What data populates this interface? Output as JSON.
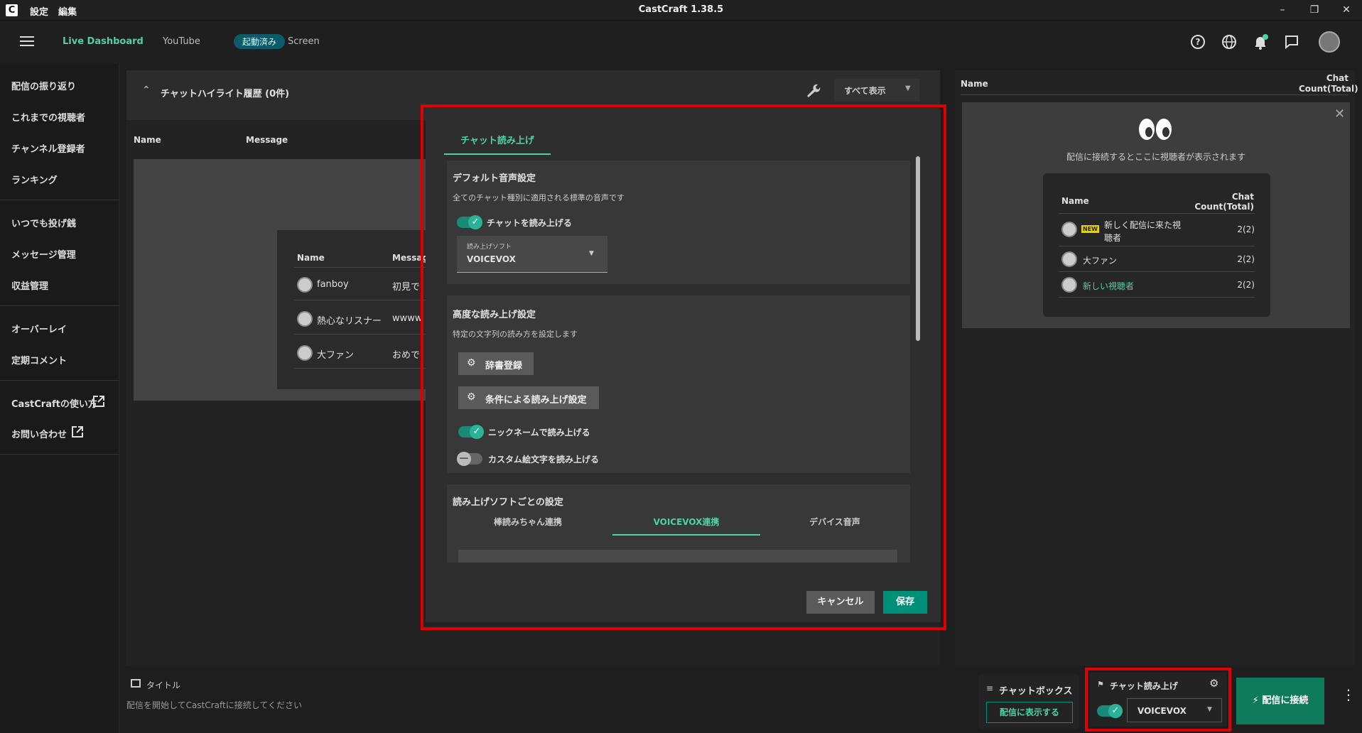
{
  "app": {
    "title": "CastCraft 1.38.5",
    "menu": [
      "設定",
      "編集"
    ],
    "logo": "C",
    "window_controls": [
      "–",
      "❐",
      "✕"
    ]
  },
  "nav": {
    "tabs": [
      "Live Dashboard",
      "YouTube"
    ],
    "status_pill": "起動済み",
    "screen_tab": "Screen",
    "icons": [
      "help-icon",
      "globe-icon",
      "bell-icon",
      "chat-icon",
      "avatar"
    ]
  },
  "sidebar": {
    "items": [
      "配信の振り返り",
      "これまでの視聴者",
      "チャンネル登録者",
      "ランキング",
      "いつでも投げ銭",
      "メッセージ管理",
      "収益管理",
      "オーバーレイ",
      "定期コメント",
      "CastCraftの使い方",
      "お問い合わせ"
    ]
  },
  "highlight": {
    "title": "チャットハイライト履歴 (0件)",
    "show_all": "すべて表示"
  },
  "chat_table": {
    "headers": [
      "Name",
      "Message"
    ],
    "rows": [
      {
        "name": "fanboy",
        "message": "初見で"
      },
      {
        "name": "熱心なリスナー",
        "message": "wwww"
      },
      {
        "name": "大ファン",
        "message": "おめで"
      }
    ]
  },
  "modal": {
    "tab": "チャット読み上げ",
    "default_section": {
      "title": "デフォルト音声設定",
      "desc": "全てのチャット種別に適用される標準の音声です",
      "toggle_label": "チャットを読み上げる",
      "select_label": "読み上げソフト",
      "select_value": "VOICEVOX"
    },
    "advanced_section": {
      "title": "高度な読み上げ設定",
      "desc": "特定の文字列の読み方を設定します",
      "dict_button": "辞書登録",
      "condition_button": "条件による読み上げ設定",
      "nickname_toggle": "ニックネームで読み上げる",
      "emoji_toggle": "カスタム絵文字を読み上げる"
    },
    "software_section": {
      "title": "読み上げソフトごとの設定",
      "tabs": [
        "棒読みちゃん連携",
        "VOICEVOX連携",
        "デバイス音声"
      ]
    },
    "cancel": "キャンセル",
    "save": "保存"
  },
  "right_panel": {
    "header_name": "Name",
    "header_count": "Chat Count(Total)",
    "empty_message": "配信に接続するとここに視聴者が表示されます",
    "demo": {
      "header_name": "Name",
      "header_count": "Chat Count(Total)",
      "badge": "NEW",
      "rows": [
        {
          "name": "新しく配信に来た視聴者",
          "count": "2(2)"
        },
        {
          "name": "大ファン",
          "count": "2(2)"
        },
        {
          "name": "新しい視聴者",
          "count": "2(2)"
        }
      ]
    }
  },
  "bottom": {
    "title_label": "タイトル",
    "title_placeholder": "配信を開始してCastCraftに接続してください",
    "chatbox_label": "チャットボックス",
    "chatbox_button": "配信に表示する",
    "tts_label": "チャット読み上げ",
    "tts_value": "VOICEVOX",
    "connect_button": "配信に接続"
  },
  "colors": {
    "accent": "#4fd1a5",
    "teal": "#00907a",
    "highlight_border": "#e00000"
  }
}
